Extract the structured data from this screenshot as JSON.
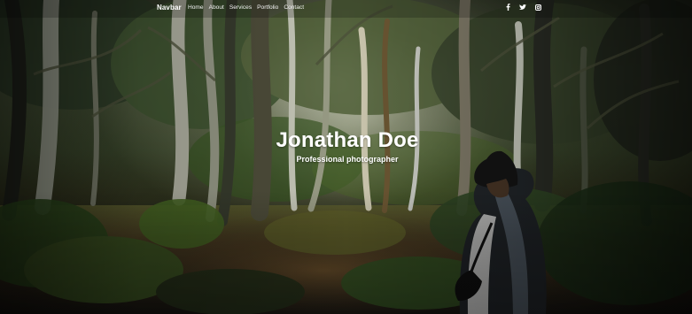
{
  "navbar": {
    "brand": "Navbar",
    "links": [
      {
        "label": "Home"
      },
      {
        "label": "About"
      },
      {
        "label": "Services"
      },
      {
        "label": "Portfolio"
      },
      {
        "label": "Contact"
      }
    ],
    "social": [
      {
        "icon": "facebook-icon"
      },
      {
        "icon": "twitter-icon"
      },
      {
        "icon": "instagram-icon"
      }
    ]
  },
  "hero": {
    "title": "Jonathan Doe",
    "subtitle": "Professional photographer"
  },
  "colors": {
    "text": "#ffffff",
    "forest_dark": "#1d221a",
    "foliage": "#4e6b2a"
  }
}
